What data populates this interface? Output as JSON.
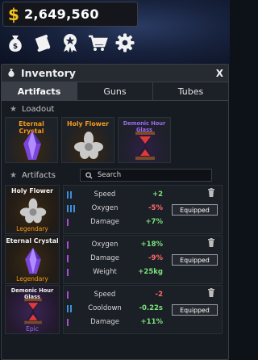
{
  "wallet": {
    "currency_symbol": "$",
    "amount": "2,649,560"
  },
  "nav_icons": [
    "money-bag-icon",
    "scroll-icon",
    "achievement-badge-icon",
    "shopping-cart-icon",
    "gear-icon"
  ],
  "panel": {
    "title": "Inventory",
    "close_label": "X"
  },
  "tabs": [
    {
      "label": "Artifacts",
      "active": true
    },
    {
      "label": "Guns",
      "active": false
    },
    {
      "label": "Tubes",
      "active": false
    }
  ],
  "loadout": {
    "label": "Loadout",
    "slots": [
      {
        "name": "Eternal Crystal",
        "color": "#f59a1d",
        "icon": "purple-crystal-icon"
      },
      {
        "name": "Holy Flower",
        "color": "#f59a1d",
        "icon": "silver-flower-icon"
      },
      {
        "name": "Demonic Hour Glass",
        "color": "#9b6cf0",
        "icon": "hourglass-icon"
      }
    ]
  },
  "artifacts": {
    "label": "Artifacts",
    "search_placeholder": "Search",
    "items": [
      {
        "name": "Holy Flower",
        "rarity": "Legendary",
        "rarity_color": "#f59a1d",
        "icon": "silver-flower-icon",
        "stats": [
          {
            "name": "Speed",
            "value": "+2",
            "value_color": "#7be37b",
            "bar_color": "#3f8ee0",
            "bars": 2
          },
          {
            "name": "Oxygen",
            "value": "-5%",
            "value_color": "#ff6b6b",
            "bar_color": "#3f8ee0",
            "bars": 3
          },
          {
            "name": "Damage",
            "value": "+7%",
            "value_color": "#7be37b",
            "bar_color": "#b04ad8",
            "bars": 1
          }
        ],
        "button": "Equipped"
      },
      {
        "name": "Eternal Crystal",
        "rarity": "Legendary",
        "rarity_color": "#f59a1d",
        "icon": "purple-crystal-icon",
        "stats": [
          {
            "name": "Oxygen",
            "value": "+18%",
            "value_color": "#7be37b",
            "bar_color": "#b04ad8",
            "bars": 1
          },
          {
            "name": "Damage",
            "value": "-9%",
            "value_color": "#ff6b6b",
            "bar_color": "#b04ad8",
            "bars": 1
          },
          {
            "name": "Weight",
            "value": "+25kg",
            "value_color": "#7be37b",
            "bar_color": "#b04ad8",
            "bars": 1
          }
        ],
        "button": "Equipped"
      },
      {
        "name": "Demonic Hour Glass",
        "rarity": "Epic",
        "rarity_color": "#9b6cf0",
        "icon": "hourglass-icon",
        "stats": [
          {
            "name": "Speed",
            "value": "-2",
            "value_color": "#ff6b6b",
            "bar_color": "#b04ad8",
            "bars": 1
          },
          {
            "name": "Cooldown",
            "value": "-0.22s",
            "value_color": "#7be37b",
            "bar_color": "#3f8ee0",
            "bars": 2
          },
          {
            "name": "Damage",
            "value": "+11%",
            "value_color": "#7be37b",
            "bar_color": "#b04ad8",
            "bars": 1
          }
        ],
        "button": "Equipped"
      }
    ]
  }
}
